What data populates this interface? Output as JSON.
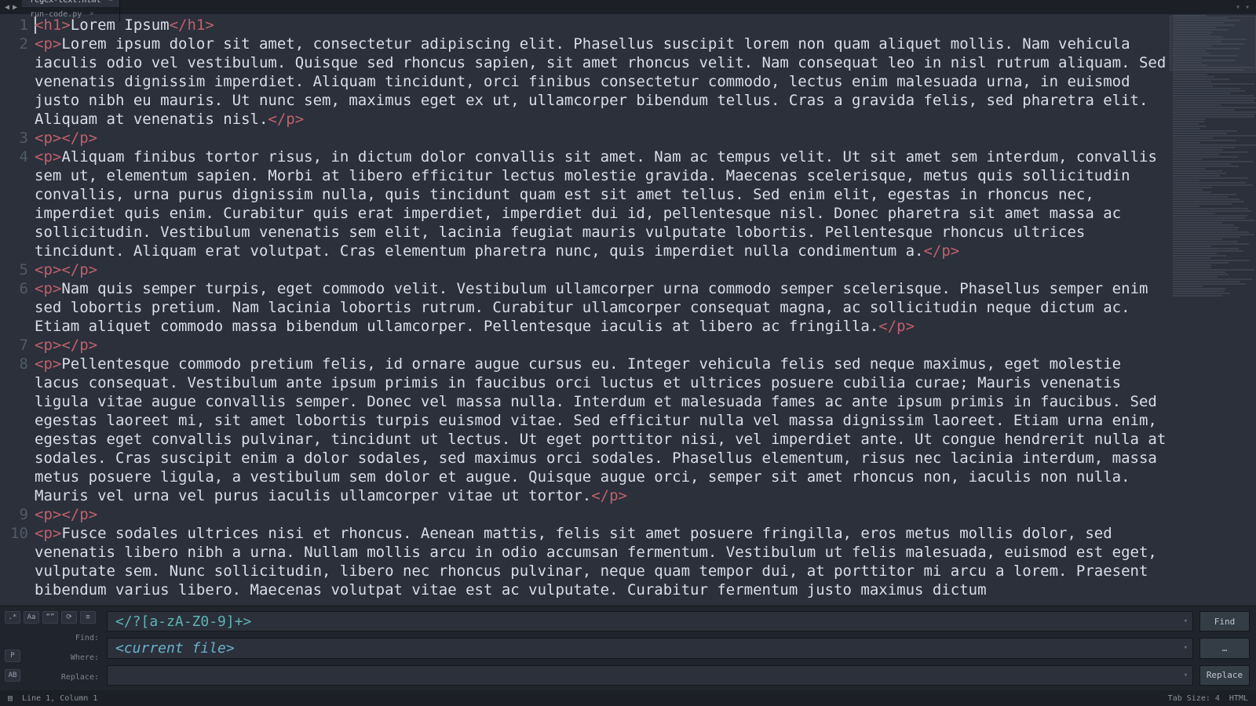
{
  "titlebar": {
    "nav_back": "◀",
    "nav_fwd": "▶",
    "right1": "▾",
    "right2": "▾"
  },
  "tabs": [
    {
      "label": "regex-text.html",
      "active": true,
      "close": "×"
    },
    {
      "label": "run-code.py",
      "active": false,
      "close": "×"
    }
  ],
  "gutter": {
    "lines": [
      "1",
      "2",
      "3",
      "4",
      "5",
      "6",
      "7",
      "8",
      "9",
      "10"
    ]
  },
  "code": {
    "lines": [
      {
        "segs": [
          {
            "cls": "tag",
            "t": "<h1>"
          },
          {
            "cls": "txt",
            "t": "Lorem Ipsum"
          },
          {
            "cls": "tag",
            "t": "</h1>"
          }
        ],
        "cursor": true
      },
      {
        "segs": [
          {
            "cls": "tag",
            "t": "<p>"
          },
          {
            "cls": "txt",
            "t": "Lorem ipsum dolor sit amet, consectetur adipiscing elit. Phasellus suscipit lorem non quam aliquet mollis. Nam vehicula iaculis odio vel vestibulum. Quisque sed rhoncus sapien, sit amet rhoncus velit. Nam consequat leo in nisl rutrum aliquam. Sed venenatis dignissim imperdiet. Aliquam tincidunt, orci finibus consectetur commodo, lectus enim malesuada urna, in euismod justo nibh eu mauris. Ut nunc sem, maximus eget ex ut, ullamcorper bibendum tellus. Cras a gravida felis, sed pharetra elit. Aliquam at venenatis nisl."
          },
          {
            "cls": "tag",
            "t": "</p>"
          }
        ]
      },
      {
        "segs": [
          {
            "cls": "tag",
            "t": "<p>"
          },
          {
            "cls": "tag",
            "t": "</p>"
          }
        ]
      },
      {
        "segs": [
          {
            "cls": "tag",
            "t": "<p>"
          },
          {
            "cls": "txt",
            "t": "Aliquam finibus tortor risus, in dictum dolor convallis sit amet. Nam ac tempus velit. Ut sit amet sem interdum, convallis sem ut, elementum sapien. Morbi at libero efficitur lectus molestie gravida. Maecenas scelerisque, metus quis sollicitudin convallis, urna purus dignissim nulla, quis tincidunt quam est sit amet tellus. Sed enim elit, egestas in rhoncus nec, imperdiet quis enim. Curabitur quis erat imperdiet, imperdiet dui id, pellentesque nisl. Donec pharetra sit amet massa ac sollicitudin. Vestibulum venenatis sem elit, lacinia feugiat mauris vulputate lobortis. Pellentesque rhoncus ultrices tincidunt. Aliquam erat volutpat. Cras elementum pharetra nunc, quis imperdiet nulla condimentum a."
          },
          {
            "cls": "tag",
            "t": "</p>"
          }
        ]
      },
      {
        "segs": [
          {
            "cls": "tag",
            "t": "<p>"
          },
          {
            "cls": "tag",
            "t": "</p>"
          }
        ]
      },
      {
        "segs": [
          {
            "cls": "tag",
            "t": "<p>"
          },
          {
            "cls": "txt",
            "t": "Nam quis semper turpis, eget commodo velit. Vestibulum ullamcorper urna commodo semper scelerisque. Phasellus semper enim sed lobortis pretium. Nam lacinia lobortis rutrum. Curabitur ullamcorper consequat magna, ac sollicitudin neque dictum ac. Etiam aliquet commodo massa bibendum ullamcorper. Pellentesque iaculis at libero ac fringilla."
          },
          {
            "cls": "tag",
            "t": "</p>"
          }
        ]
      },
      {
        "segs": [
          {
            "cls": "tag",
            "t": "<p>"
          },
          {
            "cls": "tag",
            "t": "</p>"
          }
        ]
      },
      {
        "segs": [
          {
            "cls": "tag",
            "t": "<p>"
          },
          {
            "cls": "txt",
            "t": "Pellentesque commodo pretium felis, id ornare augue cursus eu. Integer vehicula felis sed neque maximus, eget molestie lacus consequat. Vestibulum ante ipsum primis in faucibus orci luctus et ultrices posuere cubilia curae; Mauris venenatis ligula vitae augue convallis semper. Donec vel massa nulla. Interdum et malesuada fames ac ante ipsum primis in faucibus. Sed egestas laoreet mi, sit amet lobortis turpis euismod vitae. Sed efficitur nulla vel massa dignissim laoreet. Etiam urna enim, egestas eget convallis pulvinar, tincidunt ut lectus. Ut eget porttitor nisi, vel imperdiet ante. Ut congue hendrerit nulla at sodales. Cras suscipit enim a dolor sodales, sed maximus orci sodales. Phasellus elementum, risus nec lacinia interdum, massa metus posuere ligula, a vestibulum sem dolor et augue. Quisque augue orci, semper sit amet rhoncus non, iaculis non nulla. Mauris vel urna vel purus iaculis ullamcorper vitae ut tortor."
          },
          {
            "cls": "tag",
            "t": "</p>"
          }
        ]
      },
      {
        "segs": [
          {
            "cls": "tag",
            "t": "<p>"
          },
          {
            "cls": "tag",
            "t": "</p>"
          }
        ]
      },
      {
        "segs": [
          {
            "cls": "tag",
            "t": "<p>"
          },
          {
            "cls": "txt",
            "t": "Fusce sodales ultrices nisi et rhoncus. Aenean mattis, felis sit amet posuere fringilla, eros metus mollis dolor, sed venenatis libero nibh a urna. Nullam mollis arcu in odio accumsan fermentum. Vestibulum ut felis malesuada, euismod est eget, vulputate sem. Nunc sollicitudin, libero nec rhoncus pulvinar, neque quam tempor dui, at porttitor mi arcu a lorem. Praesent bibendum varius libero. Maecenas volutpat vitae est ac vulputate. Curabitur fermentum justo maximus dictum"
          }
        ]
      }
    ]
  },
  "search": {
    "toggles": {
      "regex": ".*",
      "case": "Aa",
      "word": "“”",
      "wrap": "⟳",
      "sel": "≡"
    },
    "toggle_p": "P",
    "toggle_ab": "AB",
    "find_label": "Find:",
    "where_label": "Where:",
    "replace_label": "Replace:",
    "find_value": "</?[a-zA-Z0-9]+>",
    "where_value": "<current file>",
    "replace_value": "",
    "dropdown_glyph": "▾",
    "btn_find": "Find",
    "btn_where": "…",
    "btn_replace": "Replace"
  },
  "status": {
    "menu_icon": "▤",
    "position": "Line 1, Column 1",
    "tab_size": "Tab Size: 4",
    "syntax": "HTML"
  }
}
